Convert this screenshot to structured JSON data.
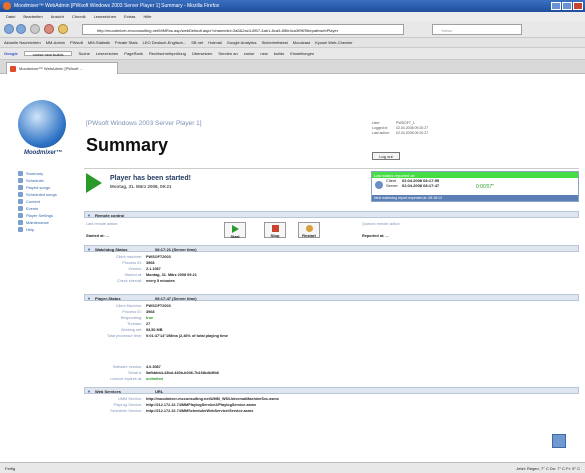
{
  "window": {
    "title": "Moodmixer™ WebAdmin [PWsoft Windows 2003 Server Player 1] Summary - Mozilla Firefox"
  },
  "menu": [
    "Datei",
    "Bearbeiten",
    "Ansicht",
    "Chronik",
    "Lesezeichen",
    "Extras",
    "Hilfe"
  ],
  "url": "http://moodmixer-mcconsulting.net/MMRos.asp/webDefault.aspx?channelid=2a5&2ac3-8f07-4ab1-8ca9-85fe4ca3f9ff/SitepathwebPlayer",
  "search_placeholder": "Yahoo",
  "bookmarks": [
    "Aktuelle Nachrichten",
    "MM-Admin",
    "PWsoft",
    "MM-Statistik",
    "Private Stats",
    "LEO Deutsch-Englisch...",
    "SB net",
    "Hotmail",
    "Google Analytics",
    "Sicherheitstest",
    "Moodcast",
    "Kyosei Web-Checker"
  ],
  "toolbar2": {
    "google": "Google",
    "search_value": "cruise new builds",
    "items": [
      "Suche",
      "Lesezeichen",
      "PageRank",
      "Rechtschreibprüfung",
      "Übersetzen",
      "Senden an",
      "cruise",
      "new",
      "builds",
      "Einstellungen"
    ]
  },
  "tab": {
    "label": "Moodmixer™ WebAdmin [PWsoft ..."
  },
  "logo": {
    "text": "Moodmixer™"
  },
  "side_menu": [
    "Summary",
    "Scheduler",
    "Played songs",
    "Scheduled songs",
    "Content",
    "Events",
    "Player Settings",
    "Maintenance",
    "Help"
  ],
  "header": {
    "subtitle": "[PWsoft Windows 2003 Server Player 1]",
    "title": "Summary",
    "status": [
      {
        "k": "User:",
        "v": "PWSOFT_1"
      },
      {
        "k": "Logged in:",
        "v": "02.04.2008 09:20:27"
      },
      {
        "k": "Last action:",
        "v": "02.04.2008 09:20:27"
      }
    ],
    "logout": "Log out"
  },
  "message": {
    "line1": "Player has been started!",
    "line2": "Montag, 31. März 2008, 09:21"
  },
  "last_status": {
    "head": "Last status reported at:",
    "client_label": "Client",
    "client_time": "02.04.2008 08:17:55",
    "server_label": "Server",
    "server_time": "02.04.2008 08:17:47",
    "diff": "0:00'07\"",
    "foot": "Next watchdog report expected at: 08:18:13"
  },
  "remote": {
    "section": "Remote control",
    "last_label": "Last remote action:",
    "last_value": "Started at: ...",
    "queued_label": "Queued remote action:",
    "queued_value": "Reported at: ...",
    "buttons": [
      "Start",
      "Stop",
      "Restart"
    ]
  },
  "watchdog": {
    "section": "Watchdog Status",
    "time": "08:17:21 (Server time)",
    "rows": [
      {
        "k": "Client machine:",
        "v": "PWSOFT2003"
      },
      {
        "k": "Process ID:",
        "v": "3968"
      },
      {
        "k": "Version:",
        "v": "2.1.1087"
      },
      {
        "k": "Started at:",
        "v": "Montag, 31. März 2008 09:21"
      },
      {
        "k": "Check interval:",
        "v": "every 5 minutes"
      }
    ]
  },
  "player": {
    "section": "Player-Status",
    "time": "08:17:47 (Server time)",
    "rows": [
      {
        "k": "Client Machine:",
        "v": "PWSOFT2003"
      },
      {
        "k": "Process ID:",
        "v": "3968"
      },
      {
        "k": "Responding:",
        "v": "true"
      },
      {
        "k": "Threads:",
        "v": "27"
      },
      {
        "k": "Working set:",
        "v": "93,50 MB"
      },
      {
        "k": "Total processor time:",
        "v": "0:01:47'14\"198ms (2,46% of total playing time"
      }
    ],
    "rows2": [
      {
        "k": "Software version:",
        "v": "4.0.3087"
      },
      {
        "k": "Serial #:",
        "v": "5afbbbb4-43bd-440b-b046-7b1f4bdb3fb8"
      },
      {
        "k": "Licence expires at:",
        "v": "unlimited"
      }
    ]
  },
  "webservices": {
    "section": "Web Services",
    "col": "URL",
    "rows": [
      {
        "k": "UMM Service:",
        "v": "http://moodmixer-mcconsulting.net/UMM_WS/UniversalMachineSvc.asmx"
      },
      {
        "k": "PlayLog Service:",
        "v": "http://212.172.22.74/MMPlaylogService2/PlaylogService.asmx"
      },
      {
        "k": "Scheduler Service:",
        "v": "http://212.172.22.74/MMSchedulerWebService/Service.asmx"
      }
    ]
  },
  "statusbar": {
    "left": "Fertig",
    "right": "Jetzt: Regen, 7° C   Do: 7° C   Fr: 9° C"
  },
  "colors": {
    "accent": "#2a9a2a",
    "status_green": "#44dd44",
    "brand_blue": "#1f4f9e"
  }
}
